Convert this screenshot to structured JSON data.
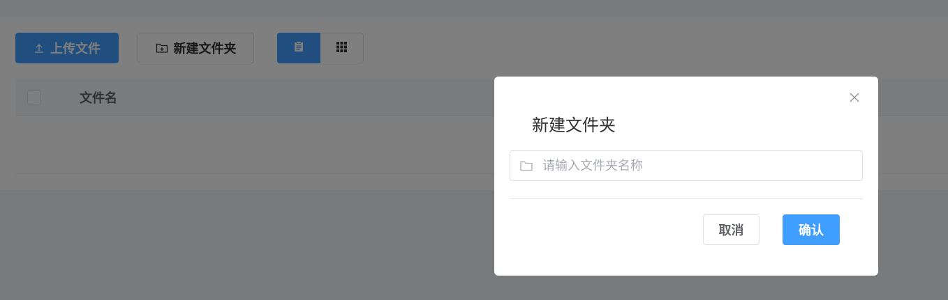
{
  "toolbar": {
    "upload_label": "上传文件",
    "upload_icon": "upload-icon",
    "new_folder_label": "新建文件夹",
    "new_folder_icon": "folder-add-icon",
    "view_list_icon": "clipboard-list-icon",
    "view_grid_icon": "grid-icon"
  },
  "table": {
    "columns": [
      "文件名"
    ]
  },
  "dialog": {
    "title": "新建文件夹",
    "close_icon": "close-icon",
    "input": {
      "value": "",
      "placeholder": "请输入文件夹名称",
      "icon": "folder-icon"
    },
    "cancel_label": "取消",
    "confirm_label": "确认"
  },
  "colors": {
    "primary": "#409eff",
    "overlay": "rgba(0,0,0,0.5)"
  }
}
